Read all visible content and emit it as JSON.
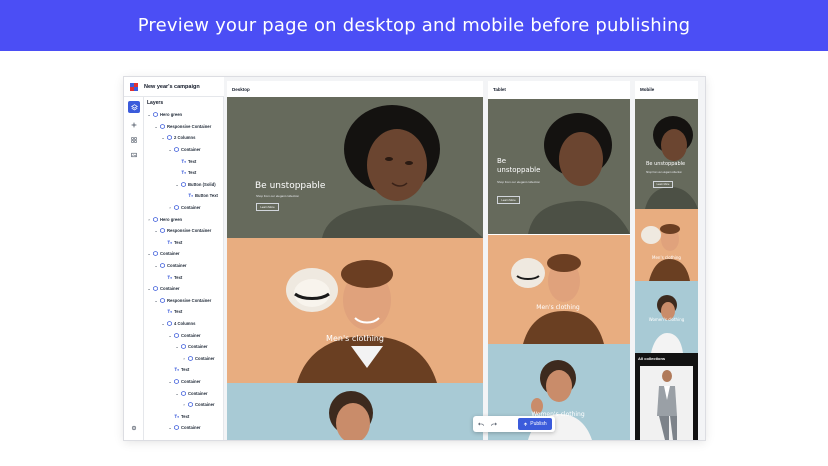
{
  "banner": {
    "text": "Preview your page on desktop and mobile before publishing"
  },
  "app": {
    "project_title": "New year's campaign",
    "rail": {
      "icons": [
        "layers-icon",
        "add-icon",
        "components-icon",
        "media-icon",
        "settings-icon"
      ]
    },
    "layers": {
      "title": "Layers",
      "items": [
        {
          "label": "Hero green",
          "depth": 0,
          "caret": "open",
          "icon": "component"
        },
        {
          "label": "Responsive Container",
          "depth": 1,
          "caret": "open",
          "icon": "component"
        },
        {
          "label": "2 Columns",
          "depth": 2,
          "caret": "open",
          "icon": "component"
        },
        {
          "label": "Container",
          "depth": 3,
          "caret": "open",
          "icon": "component"
        },
        {
          "label": "Text",
          "depth": 4,
          "caret": "none",
          "icon": "text"
        },
        {
          "label": "Text",
          "depth": 4,
          "caret": "none",
          "icon": "text"
        },
        {
          "label": "Button (Solid)",
          "depth": 4,
          "caret": "open",
          "icon": "component"
        },
        {
          "label": "Button Text",
          "depth": 5,
          "caret": "none",
          "icon": "text"
        },
        {
          "label": "Container",
          "depth": 3,
          "caret": "closed",
          "icon": "component"
        },
        {
          "label": "Hero green",
          "depth": 0,
          "caret": "closed",
          "icon": "component"
        },
        {
          "label": "Responsive Container",
          "depth": 1,
          "caret": "open",
          "icon": "component"
        },
        {
          "label": "Text",
          "depth": 2,
          "caret": "none",
          "icon": "text"
        },
        {
          "label": "Container",
          "depth": 0,
          "caret": "open",
          "icon": "component"
        },
        {
          "label": "Container",
          "depth": 1,
          "caret": "open",
          "icon": "component"
        },
        {
          "label": "Text",
          "depth": 2,
          "caret": "none",
          "icon": "text"
        },
        {
          "label": "Container",
          "depth": 0,
          "caret": "open",
          "icon": "component"
        },
        {
          "label": "Responsive Container",
          "depth": 1,
          "caret": "open",
          "icon": "component"
        },
        {
          "label": "Text",
          "depth": 2,
          "caret": "none",
          "icon": "text"
        },
        {
          "label": "4 Columns",
          "depth": 2,
          "caret": "open",
          "icon": "component"
        },
        {
          "label": "Container",
          "depth": 3,
          "caret": "open",
          "icon": "component"
        },
        {
          "label": "Container",
          "depth": 4,
          "caret": "open",
          "icon": "component"
        },
        {
          "label": "Container",
          "depth": 5,
          "caret": "closed",
          "icon": "component"
        },
        {
          "label": "Text",
          "depth": 3,
          "caret": "none",
          "icon": "text"
        },
        {
          "label": "Container",
          "depth": 3,
          "caret": "open",
          "icon": "component"
        },
        {
          "label": "Container",
          "depth": 4,
          "caret": "open",
          "icon": "component"
        },
        {
          "label": "Container",
          "depth": 5,
          "caret": "closed",
          "icon": "component"
        },
        {
          "label": "Text",
          "depth": 3,
          "caret": "none",
          "icon": "text"
        },
        {
          "label": "Container",
          "depth": 3,
          "caret": "open",
          "icon": "component"
        }
      ]
    },
    "frames": {
      "desktop": {
        "label": "Desktop",
        "hero_title": "Be unstoppable",
        "hero_sub": "Shop from our elegant collection",
        "hero_button": "Learn More",
        "card1_title": "Men's clothing"
      },
      "tablet": {
        "label": "Tablet",
        "hero_title": "Be unstoppable",
        "hero_sub": "Shop from our elegant collection",
        "hero_button": "Learn More",
        "card1_title": "Men's clothing",
        "card2_title": "Women's clothing"
      },
      "mobile": {
        "label": "Mobile",
        "hero_title": "Be unstoppable",
        "hero_sub": "Shop from our elegant collection",
        "hero_button": "Learn More",
        "card1_title": "Men's clothing",
        "card2_title": "Women's clothing",
        "collections_label": "All collections"
      }
    },
    "toolbar": {
      "undo_icon": "undo-icon",
      "redo_icon": "redo-icon",
      "publish_label": "Publish"
    },
    "colors": {
      "banner": "#4b4ef5",
      "accent": "#3b5bdb",
      "hero_bg": "#666a5c",
      "peach_bg": "#e8ad80",
      "blue_bg": "#a8cad5"
    }
  }
}
